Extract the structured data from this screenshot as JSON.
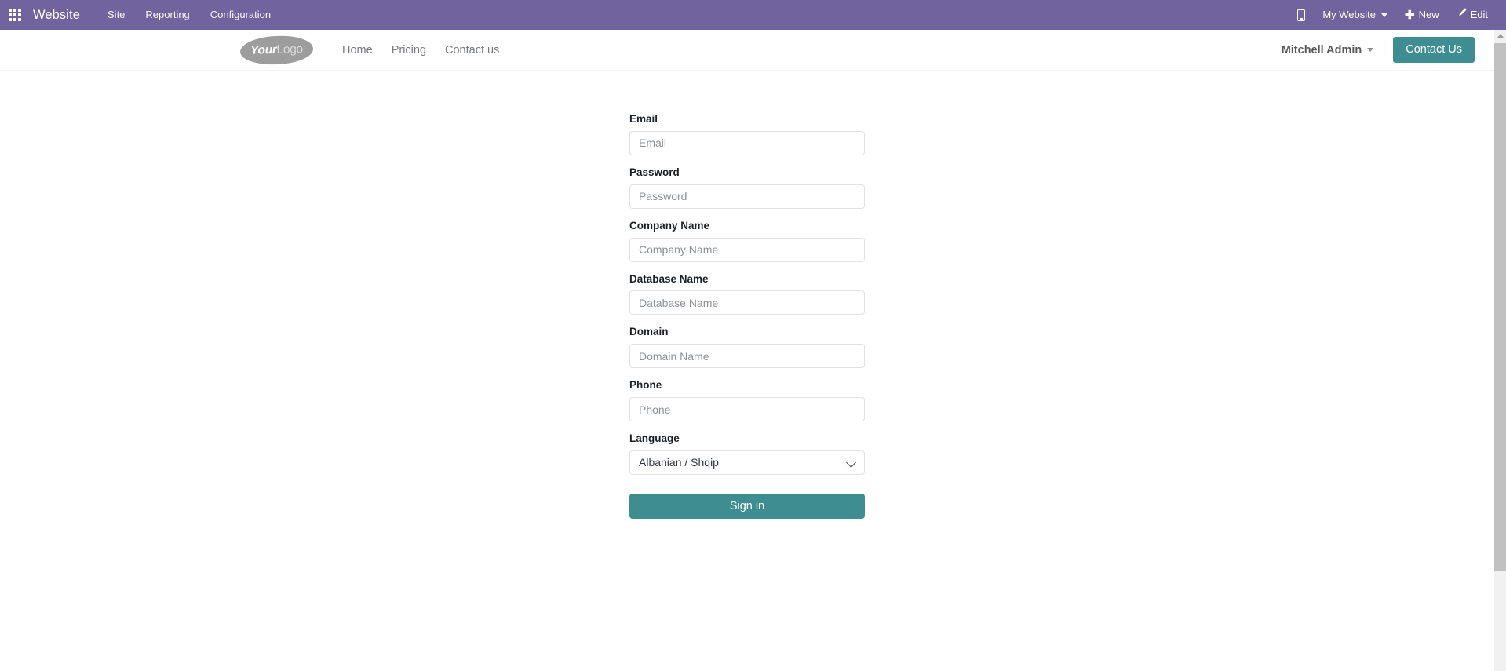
{
  "systray": {
    "apps_icon": "apps-grid-icon",
    "brand": "Website",
    "menus": [
      {
        "label": "Site"
      },
      {
        "label": "Reporting"
      },
      {
        "label": "Configuration"
      }
    ],
    "right": {
      "mobile_preview_icon": "mobile-phone-icon",
      "website_switcher": "My Website",
      "new_icon": "plus-icon",
      "new_label": "New",
      "edit_icon": "pencil-icon",
      "edit_label": "Edit"
    }
  },
  "site_header": {
    "logo": {
      "word1": "Your",
      "word2": "Logo"
    },
    "nav": [
      {
        "label": "Home"
      },
      {
        "label": "Pricing"
      },
      {
        "label": "Contact us"
      }
    ],
    "user_menu": "Mitchell Admin",
    "cta_button": "Contact Us"
  },
  "form": {
    "fields": [
      {
        "name": "email",
        "label": "Email",
        "placeholder": "Email",
        "value": "",
        "type": "text"
      },
      {
        "name": "password",
        "label": "Password",
        "placeholder": "Password",
        "value": "",
        "type": "password"
      },
      {
        "name": "company",
        "label": "Company Name",
        "placeholder": "Company Name",
        "value": "",
        "type": "text"
      },
      {
        "name": "database",
        "label": "Database Name",
        "placeholder": "Database Name",
        "value": "",
        "type": "text"
      },
      {
        "name": "domain",
        "label": "Domain",
        "placeholder": "Domain Name",
        "value": "",
        "type": "text"
      },
      {
        "name": "phone",
        "label": "Phone",
        "placeholder": "Phone",
        "value": "",
        "type": "text"
      }
    ],
    "language": {
      "label": "Language",
      "selected": "Albanian / Shqip",
      "options": [
        "Albanian / Shqip"
      ],
      "chevron_icon": "chevron-down-icon"
    },
    "submit_label": "Sign in"
  },
  "scrollbar": {
    "up_arrow_icon": "scroll-up-arrow-icon"
  },
  "colors": {
    "systray_purple": "#71639e",
    "accent_teal": "#3e8e91",
    "input_border": "#dfe1e4",
    "placeholder": "#8d9196",
    "label_text": "#1c2127"
  }
}
